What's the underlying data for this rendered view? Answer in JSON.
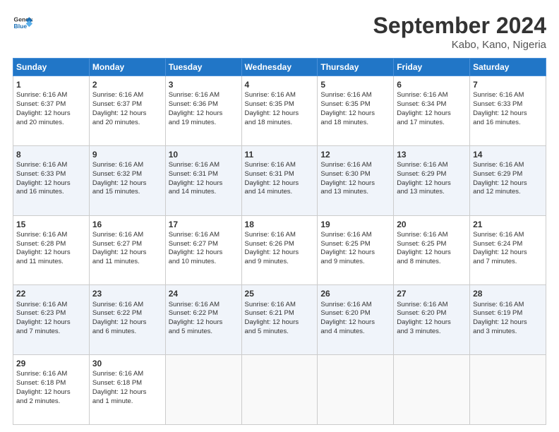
{
  "header": {
    "logo_line1": "General",
    "logo_line2": "Blue",
    "month_title": "September 2024",
    "location": "Kabo, Kano, Nigeria"
  },
  "days_of_week": [
    "Sunday",
    "Monday",
    "Tuesday",
    "Wednesday",
    "Thursday",
    "Friday",
    "Saturday"
  ],
  "weeks": [
    [
      {
        "day": "1",
        "lines": [
          "Sunrise: 6:16 AM",
          "Sunset: 6:37 PM",
          "Daylight: 12 hours",
          "and 20 minutes."
        ]
      },
      {
        "day": "2",
        "lines": [
          "Sunrise: 6:16 AM",
          "Sunset: 6:37 PM",
          "Daylight: 12 hours",
          "and 20 minutes."
        ]
      },
      {
        "day": "3",
        "lines": [
          "Sunrise: 6:16 AM",
          "Sunset: 6:36 PM",
          "Daylight: 12 hours",
          "and 19 minutes."
        ]
      },
      {
        "day": "4",
        "lines": [
          "Sunrise: 6:16 AM",
          "Sunset: 6:35 PM",
          "Daylight: 12 hours",
          "and 18 minutes."
        ]
      },
      {
        "day": "5",
        "lines": [
          "Sunrise: 6:16 AM",
          "Sunset: 6:35 PM",
          "Daylight: 12 hours",
          "and 18 minutes."
        ]
      },
      {
        "day": "6",
        "lines": [
          "Sunrise: 6:16 AM",
          "Sunset: 6:34 PM",
          "Daylight: 12 hours",
          "and 17 minutes."
        ]
      },
      {
        "day": "7",
        "lines": [
          "Sunrise: 6:16 AM",
          "Sunset: 6:33 PM",
          "Daylight: 12 hours",
          "and 16 minutes."
        ]
      }
    ],
    [
      {
        "day": "8",
        "lines": [
          "Sunrise: 6:16 AM",
          "Sunset: 6:33 PM",
          "Daylight: 12 hours",
          "and 16 minutes."
        ]
      },
      {
        "day": "9",
        "lines": [
          "Sunrise: 6:16 AM",
          "Sunset: 6:32 PM",
          "Daylight: 12 hours",
          "and 15 minutes."
        ]
      },
      {
        "day": "10",
        "lines": [
          "Sunrise: 6:16 AM",
          "Sunset: 6:31 PM",
          "Daylight: 12 hours",
          "and 14 minutes."
        ]
      },
      {
        "day": "11",
        "lines": [
          "Sunrise: 6:16 AM",
          "Sunset: 6:31 PM",
          "Daylight: 12 hours",
          "and 14 minutes."
        ]
      },
      {
        "day": "12",
        "lines": [
          "Sunrise: 6:16 AM",
          "Sunset: 6:30 PM",
          "Daylight: 12 hours",
          "and 13 minutes."
        ]
      },
      {
        "day": "13",
        "lines": [
          "Sunrise: 6:16 AM",
          "Sunset: 6:29 PM",
          "Daylight: 12 hours",
          "and 13 minutes."
        ]
      },
      {
        "day": "14",
        "lines": [
          "Sunrise: 6:16 AM",
          "Sunset: 6:29 PM",
          "Daylight: 12 hours",
          "and 12 minutes."
        ]
      }
    ],
    [
      {
        "day": "15",
        "lines": [
          "Sunrise: 6:16 AM",
          "Sunset: 6:28 PM",
          "Daylight: 12 hours",
          "and 11 minutes."
        ]
      },
      {
        "day": "16",
        "lines": [
          "Sunrise: 6:16 AM",
          "Sunset: 6:27 PM",
          "Daylight: 12 hours",
          "and 11 minutes."
        ]
      },
      {
        "day": "17",
        "lines": [
          "Sunrise: 6:16 AM",
          "Sunset: 6:27 PM",
          "Daylight: 12 hours",
          "and 10 minutes."
        ]
      },
      {
        "day": "18",
        "lines": [
          "Sunrise: 6:16 AM",
          "Sunset: 6:26 PM",
          "Daylight: 12 hours",
          "and 9 minutes."
        ]
      },
      {
        "day": "19",
        "lines": [
          "Sunrise: 6:16 AM",
          "Sunset: 6:25 PM",
          "Daylight: 12 hours",
          "and 9 minutes."
        ]
      },
      {
        "day": "20",
        "lines": [
          "Sunrise: 6:16 AM",
          "Sunset: 6:25 PM",
          "Daylight: 12 hours",
          "and 8 minutes."
        ]
      },
      {
        "day": "21",
        "lines": [
          "Sunrise: 6:16 AM",
          "Sunset: 6:24 PM",
          "Daylight: 12 hours",
          "and 7 minutes."
        ]
      }
    ],
    [
      {
        "day": "22",
        "lines": [
          "Sunrise: 6:16 AM",
          "Sunset: 6:23 PM",
          "Daylight: 12 hours",
          "and 7 minutes."
        ]
      },
      {
        "day": "23",
        "lines": [
          "Sunrise: 6:16 AM",
          "Sunset: 6:22 PM",
          "Daylight: 12 hours",
          "and 6 minutes."
        ]
      },
      {
        "day": "24",
        "lines": [
          "Sunrise: 6:16 AM",
          "Sunset: 6:22 PM",
          "Daylight: 12 hours",
          "and 5 minutes."
        ]
      },
      {
        "day": "25",
        "lines": [
          "Sunrise: 6:16 AM",
          "Sunset: 6:21 PM",
          "Daylight: 12 hours",
          "and 5 minutes."
        ]
      },
      {
        "day": "26",
        "lines": [
          "Sunrise: 6:16 AM",
          "Sunset: 6:20 PM",
          "Daylight: 12 hours",
          "and 4 minutes."
        ]
      },
      {
        "day": "27",
        "lines": [
          "Sunrise: 6:16 AM",
          "Sunset: 6:20 PM",
          "Daylight: 12 hours",
          "and 3 minutes."
        ]
      },
      {
        "day": "28",
        "lines": [
          "Sunrise: 6:16 AM",
          "Sunset: 6:19 PM",
          "Daylight: 12 hours",
          "and 3 minutes."
        ]
      }
    ],
    [
      {
        "day": "29",
        "lines": [
          "Sunrise: 6:16 AM",
          "Sunset: 6:18 PM",
          "Daylight: 12 hours",
          "and 2 minutes."
        ]
      },
      {
        "day": "30",
        "lines": [
          "Sunrise: 6:16 AM",
          "Sunset: 6:18 PM",
          "Daylight: 12 hours",
          "and 1 minute."
        ]
      },
      {
        "day": "",
        "lines": []
      },
      {
        "day": "",
        "lines": []
      },
      {
        "day": "",
        "lines": []
      },
      {
        "day": "",
        "lines": []
      },
      {
        "day": "",
        "lines": []
      }
    ]
  ]
}
